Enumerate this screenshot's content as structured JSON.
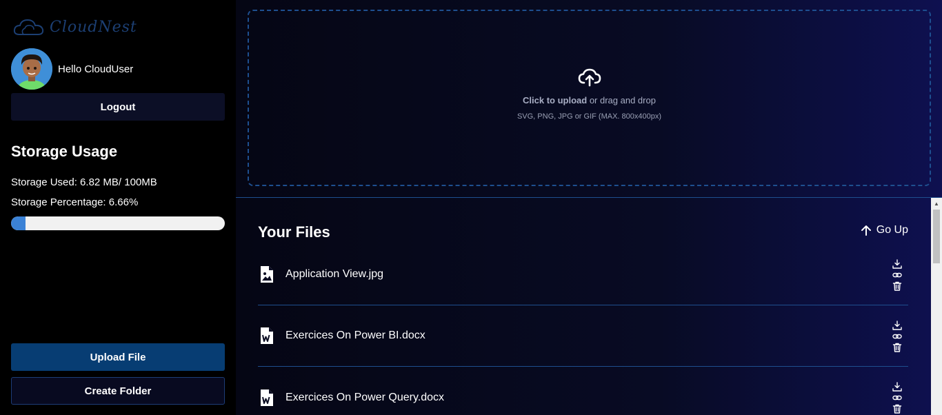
{
  "brand": {
    "name": "CloudNest"
  },
  "user": {
    "greeting": "Hello CloudUser"
  },
  "sidebar": {
    "logout_label": "Logout",
    "storage_title": "Storage Usage",
    "storage_used": "Storage Used: 6.82 MB/ 100MB",
    "storage_percentage": "Storage Percentage: 6.66%",
    "storage_fraction": 0.0666,
    "upload_label": "Upload File",
    "create_folder_label": "Create Folder"
  },
  "dropzone": {
    "icon": "cloud-upload-icon",
    "click_text": "Click to upload",
    "rest_text": " or drag and drop",
    "hint": "SVG, PNG, JPG or GIF (MAX. 800x400px)"
  },
  "files": {
    "title": "Your Files",
    "go_up_label": "Go Up",
    "items": [
      {
        "name": "Application View.jpg",
        "icon": "image-file-icon"
      },
      {
        "name": "Exercices On Power BI.docx",
        "icon": "word-file-icon"
      },
      {
        "name": "Exercices On Power Query.docx",
        "icon": "word-file-icon"
      }
    ]
  },
  "colors": {
    "accent": "#3b82d6",
    "upload_button": "#073d73",
    "divider": "#1e4f8f"
  }
}
